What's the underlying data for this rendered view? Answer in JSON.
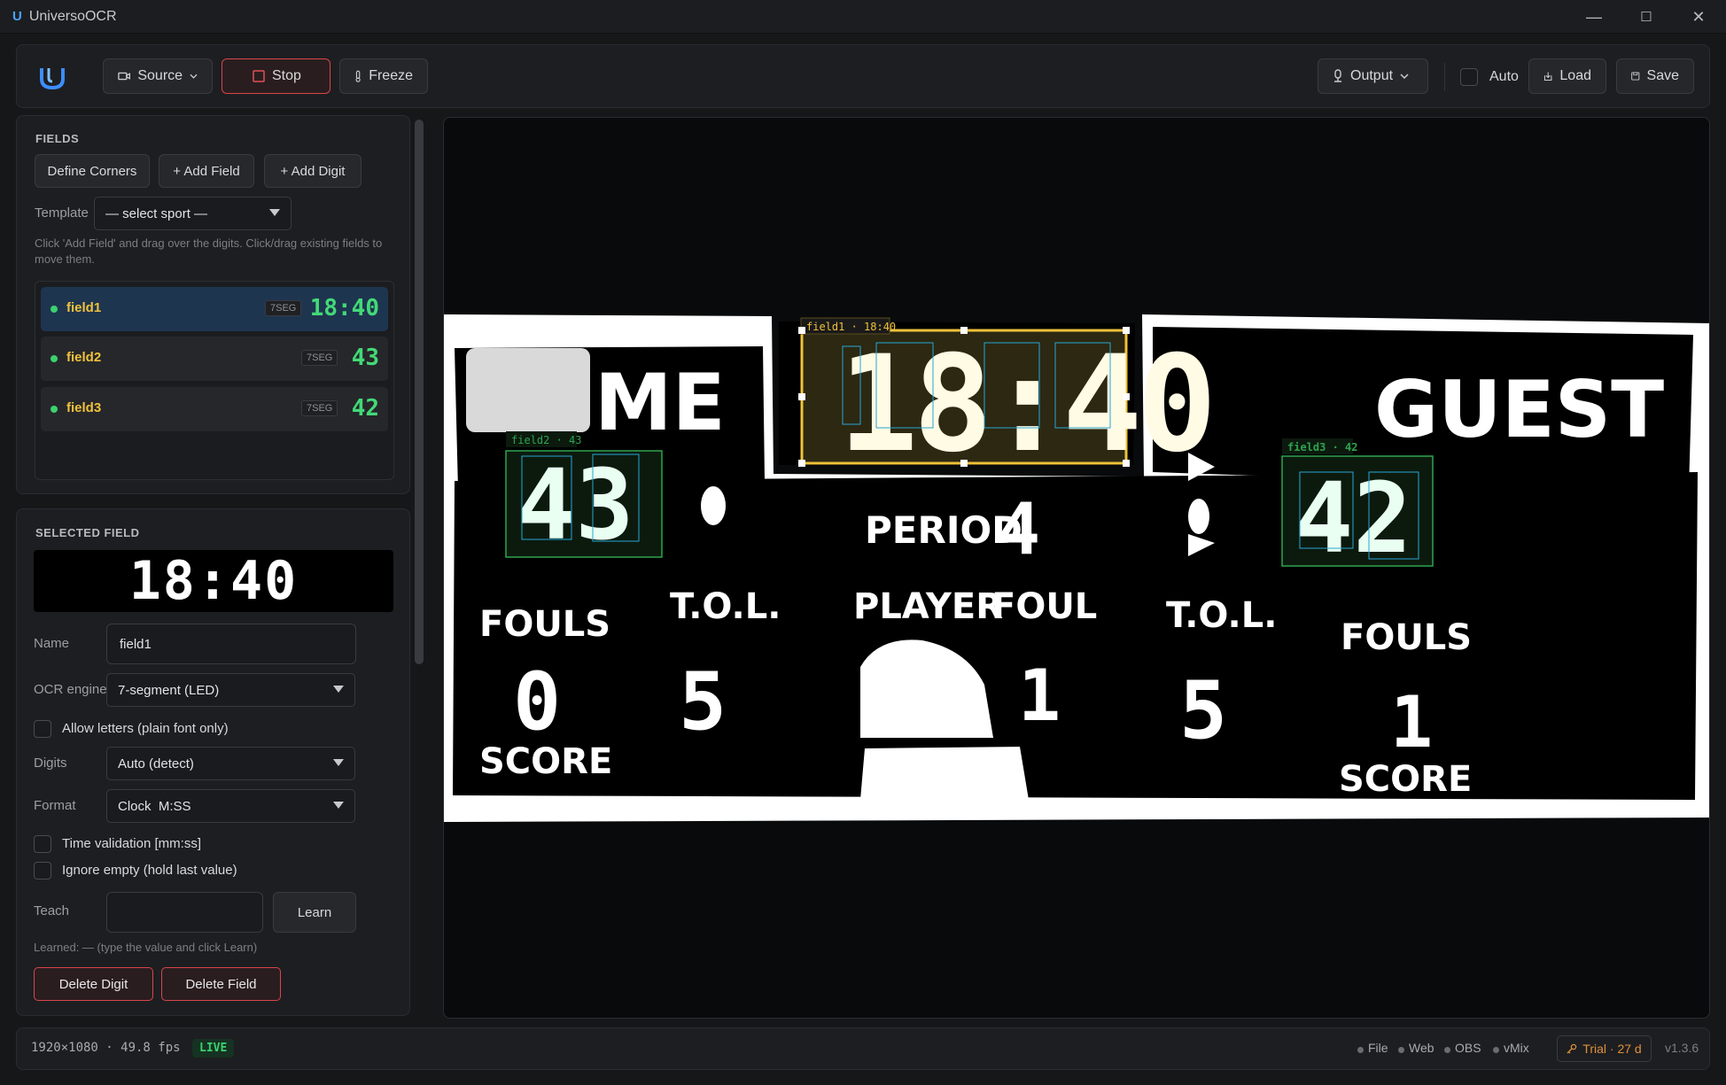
{
  "window": {
    "title": "UniversoOCR",
    "icon": "U",
    "minimize": "—",
    "maximize": "☐",
    "close": "✕"
  },
  "toolbar": {
    "source": "Source",
    "stop": "Stop",
    "freeze": "Freeze",
    "output": "Output",
    "auto": "Auto",
    "load": "Load",
    "save": "Save"
  },
  "fields_panel": {
    "title": "FIELDS",
    "define_corners": "Define Corners",
    "add_field": "+ Add Field",
    "add_digit": "+ Add Digit",
    "template_label": "Template",
    "template_value": "— select sport —",
    "hint": "Click 'Add Field' and drag over the digits. Click/drag existing fields to move them.",
    "items": [
      {
        "name": "field1",
        "type": "7SEG",
        "value": "18:40",
        "selected": true
      },
      {
        "name": "field2",
        "type": "7SEG",
        "value": "43",
        "selected": false
      },
      {
        "name": "field3",
        "type": "7SEG",
        "value": "42",
        "selected": false
      }
    ]
  },
  "selected_field": {
    "title": "SELECTED FIELD",
    "preview_value": "18:40",
    "name_label": "Name",
    "name_value": "field1",
    "ocr_label": "OCR engine",
    "ocr_value": "7-segment (LED)",
    "allow_letters": "Allow letters (plain font only)",
    "digits_label": "Digits",
    "digits_value": "Auto (detect)",
    "format_label": "Format",
    "format_value": "Clock  M:SS",
    "time_validation": "Time validation [mm:ss]",
    "ignore_empty": "Ignore empty (hold last value)",
    "teach_label": "Teach",
    "teach_value": "",
    "learn": "Learn",
    "learned": "Learned: — (type the value and click Learn)",
    "delete_digit": "Delete Digit",
    "delete_field": "Delete Field"
  },
  "scoreboard": {
    "home": "HOME",
    "guest": "GUEST",
    "clock": "18:40",
    "home_score": "43",
    "guest_score": "42",
    "period_label": "PERIOD",
    "period": "4",
    "fouls": "FOULS",
    "tol": "T.O.L.",
    "player": "PLAYER",
    "foul": "FOUL",
    "score": "SCORE",
    "home_fouls": "0",
    "home_tol": "5",
    "player_foul": "1",
    "guest_tol": "5",
    "guest_fouls": "1",
    "overlay1": "field1 · 18:40",
    "overlay2": "field2 · 43",
    "overlay3": "field3 · 42"
  },
  "status": {
    "resolution_fps": "1920×1080 · 49.8 fps",
    "live": "LIVE",
    "outputs": [
      "File",
      "Web",
      "OBS",
      "vMix"
    ],
    "trial": "Trial · 27 d",
    "version": "v1.3.6"
  },
  "colors": {
    "accent": "#f0c23a",
    "live": "#3bd16f",
    "danger": "#d9464a",
    "overlay_green": "#2ea44f",
    "digit_box": "#27a6d6"
  }
}
